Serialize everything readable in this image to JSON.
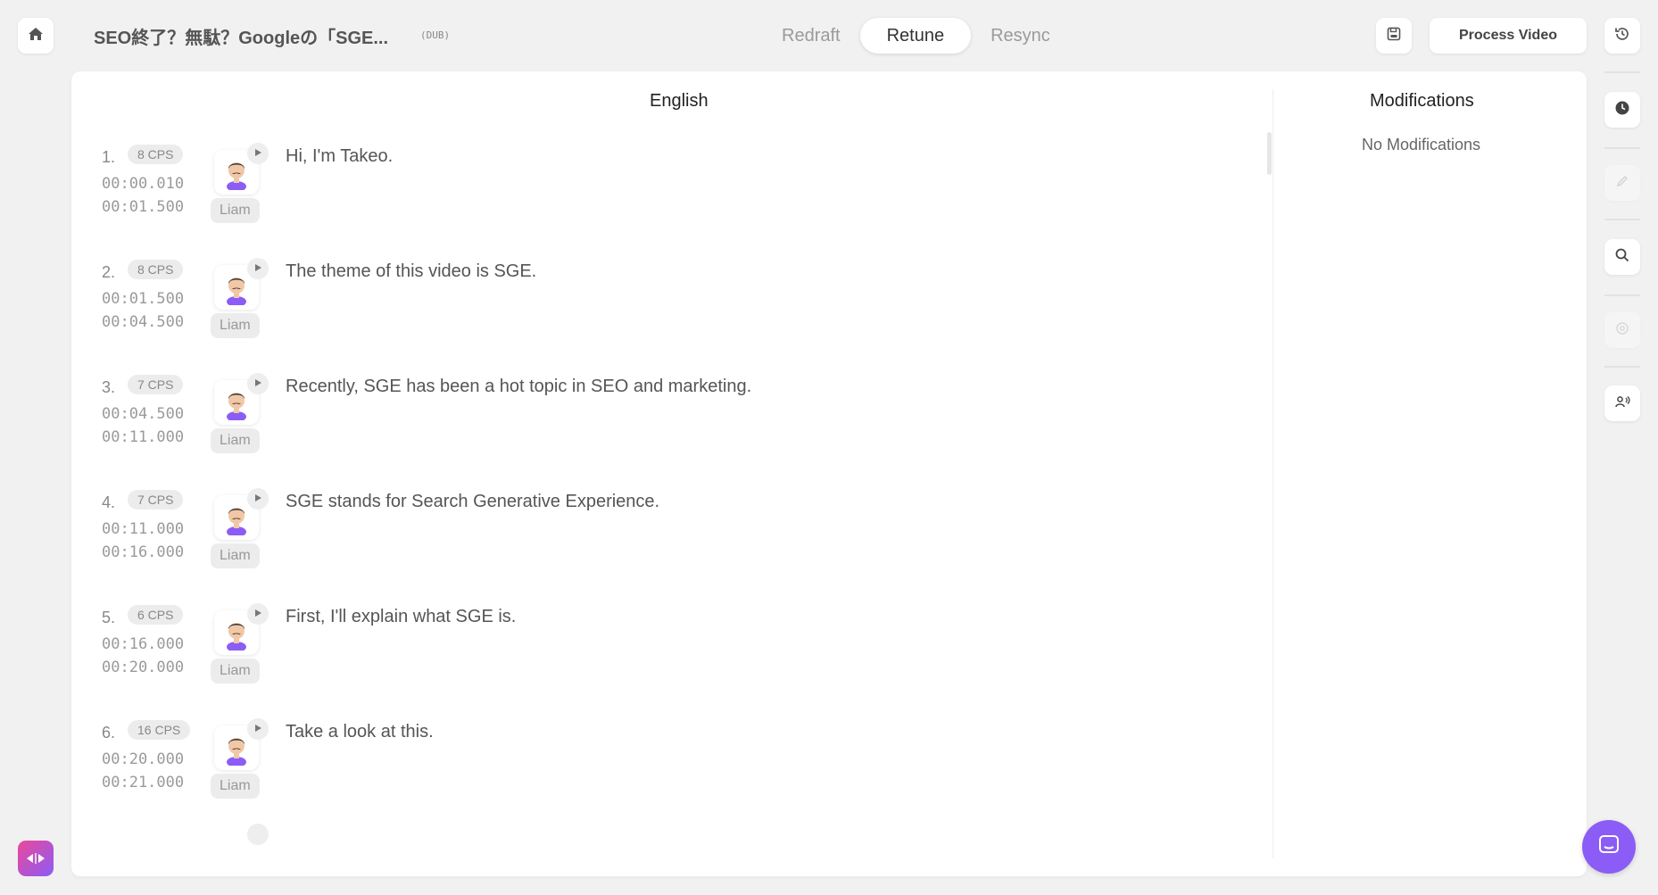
{
  "header": {
    "home_icon": "home-icon",
    "title": "SEO終了？無駄？Googleの「SGE...",
    "badge": "(DUB)",
    "tabs": [
      {
        "label": "Redraft",
        "active": false
      },
      {
        "label": "Retune",
        "active": true
      },
      {
        "label": "Resync",
        "active": false
      }
    ],
    "save_icon": "save-icon",
    "process_label": "Process Video",
    "history_icon": "history-icon"
  },
  "main": {
    "language_heading": "English",
    "modifications_heading": "Modifications",
    "no_modifications": "No Modifications",
    "segments": [
      {
        "num": "1.",
        "cps": "8 CPS",
        "start": "00:00.010",
        "end": "00:01.500",
        "speaker": "Liam",
        "text": "Hi, I'm Takeo."
      },
      {
        "num": "2.",
        "cps": "8 CPS",
        "start": "00:01.500",
        "end": "00:04.500",
        "speaker": "Liam",
        "text": "The theme of this video is SGE."
      },
      {
        "num": "3.",
        "cps": "7 CPS",
        "start": "00:04.500",
        "end": "00:11.000",
        "speaker": "Liam",
        "text": "Recently, SGE has been a hot topic in SEO and marketing."
      },
      {
        "num": "4.",
        "cps": "7 CPS",
        "start": "00:11.000",
        "end": "00:16.000",
        "speaker": "Liam",
        "text": "SGE stands for Search Generative Experience."
      },
      {
        "num": "5.",
        "cps": "6 CPS",
        "start": "00:16.000",
        "end": "00:20.000",
        "speaker": "Liam",
        "text": "First, I'll explain what SGE is."
      },
      {
        "num": "6.",
        "cps": "16 CPS",
        "start": "00:20.000",
        "end": "00:21.000",
        "speaker": "Liam",
        "text": "Take a look at this."
      }
    ]
  },
  "right_toolbar": [
    "clock-icon",
    "pen-icon",
    "search-icon",
    "settings-icon",
    "voice-icon"
  ],
  "colors": {
    "accent": "#8b5cf6",
    "brand_gradient_start": "#ec4899"
  }
}
